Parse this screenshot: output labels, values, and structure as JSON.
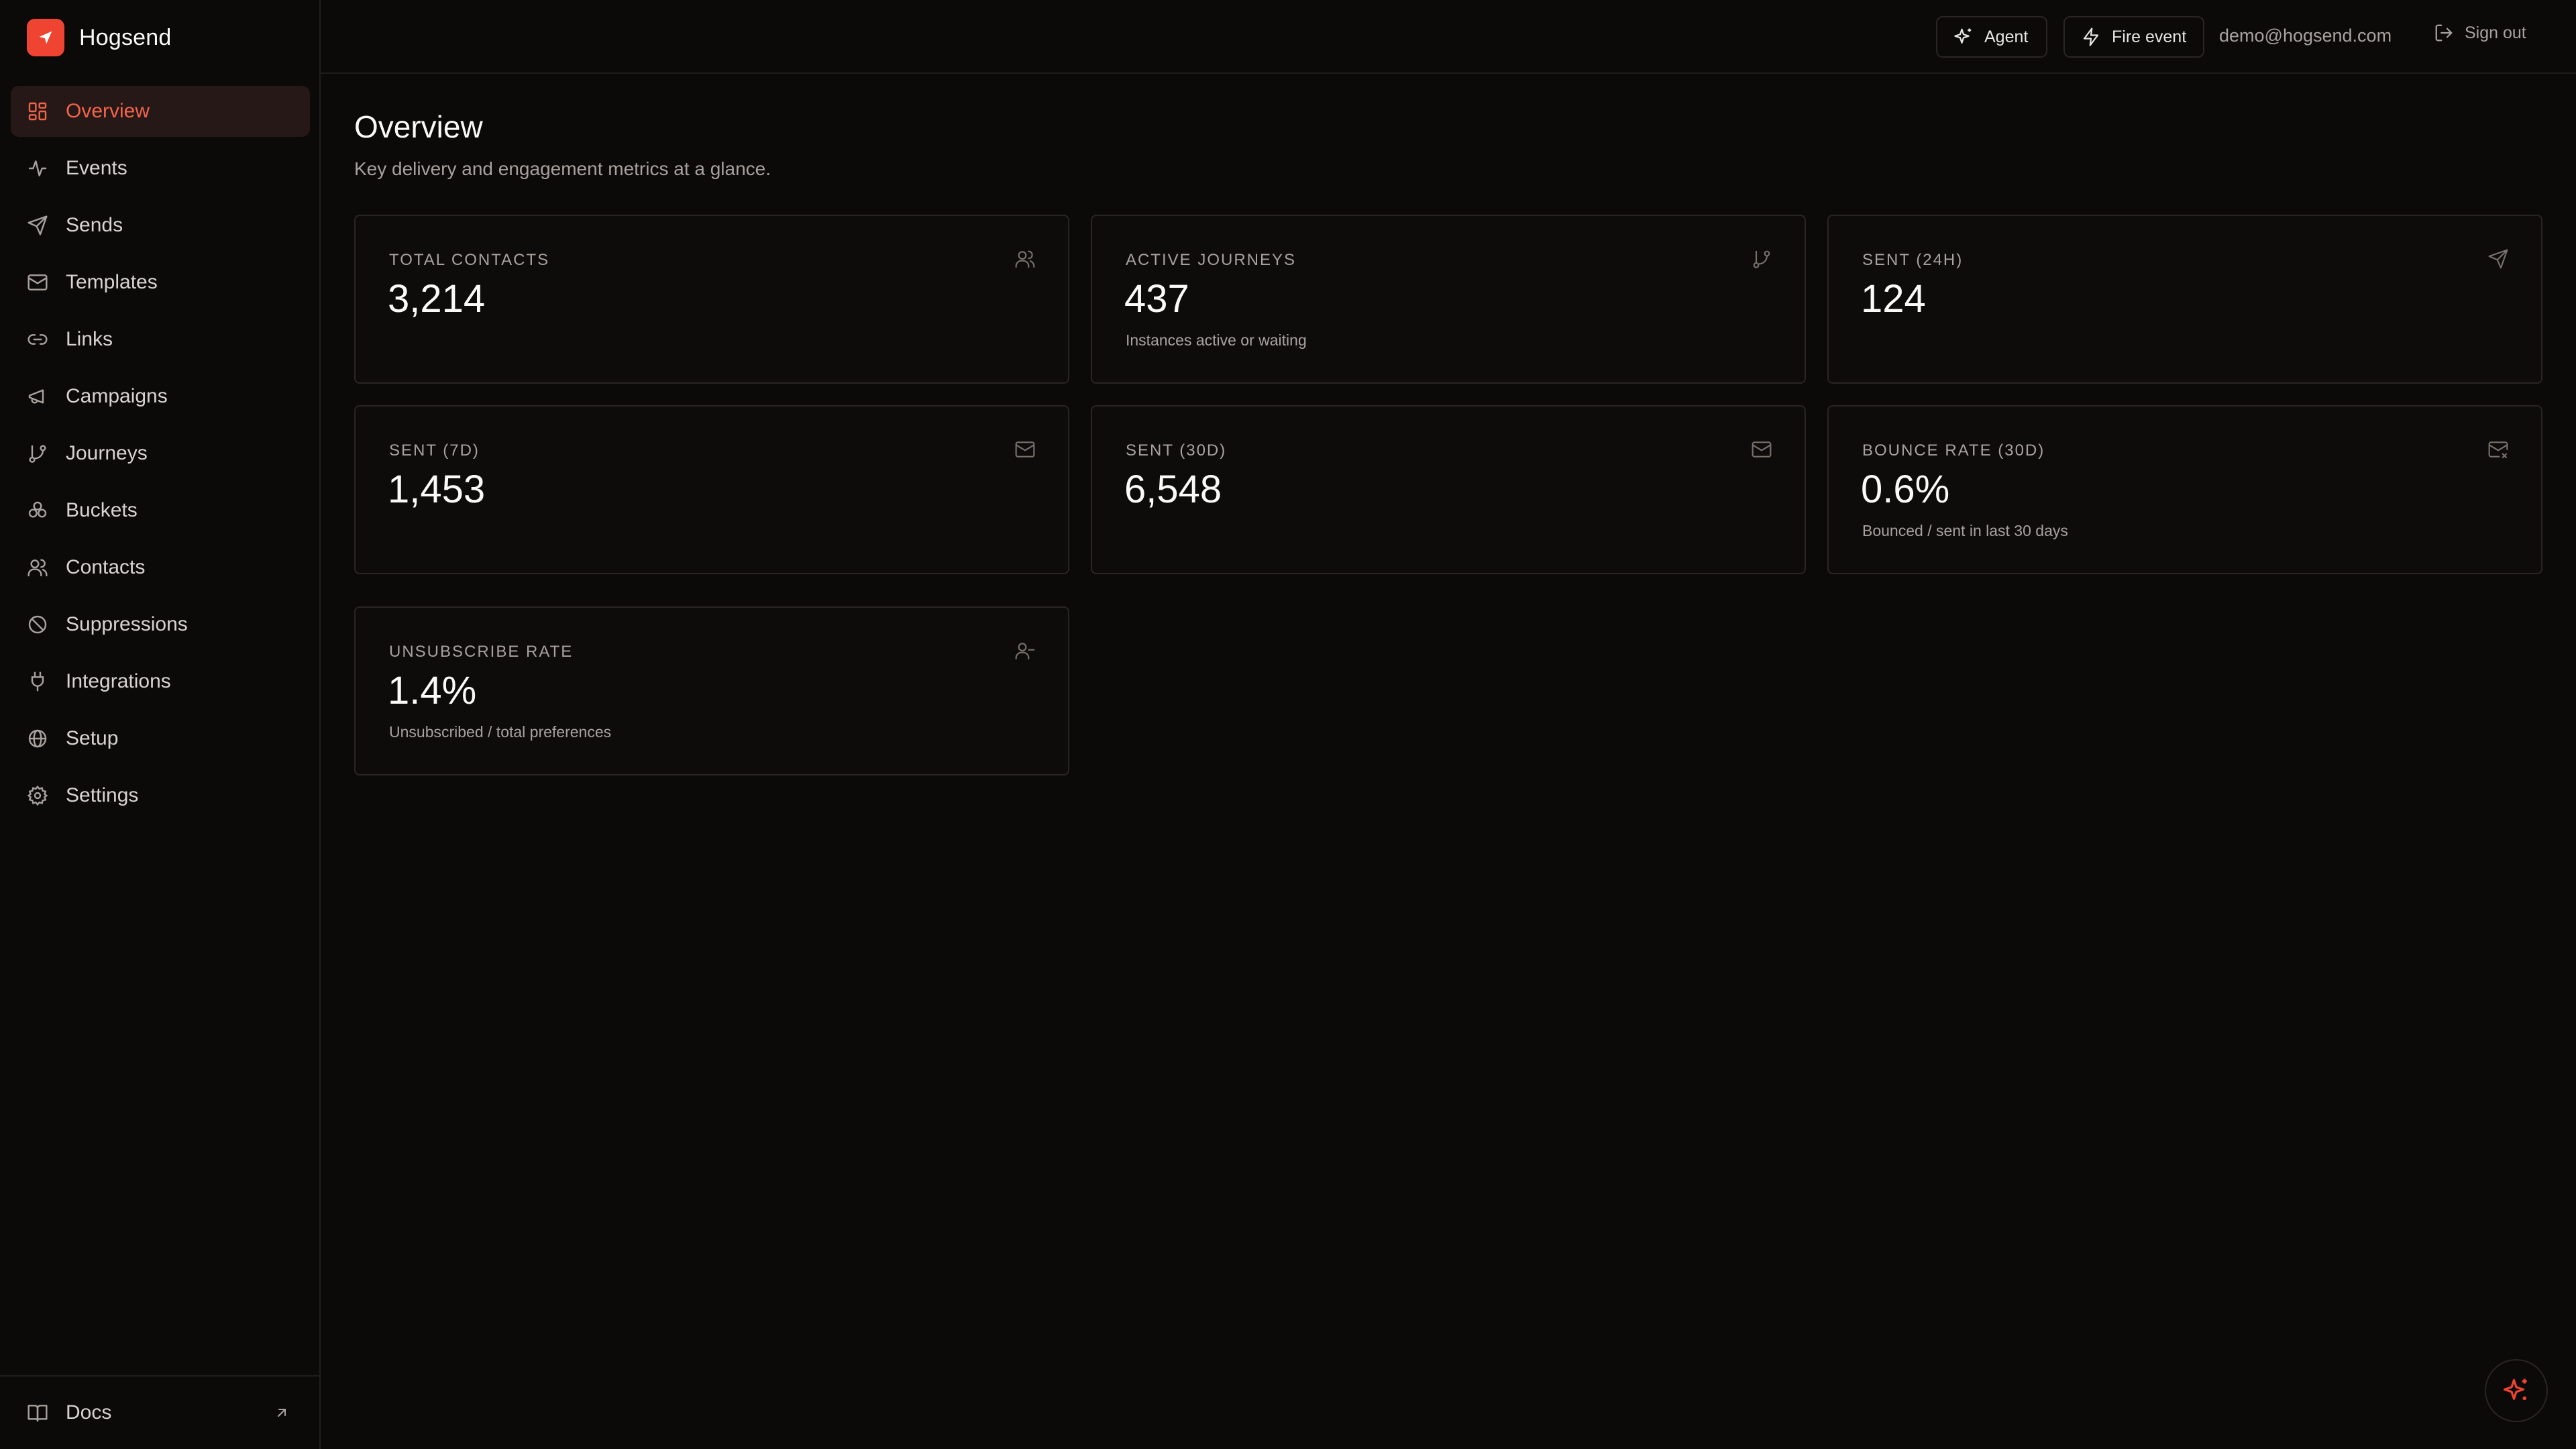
{
  "brand": {
    "name": "Hogsend",
    "accent": "#ef4432"
  },
  "sidebar": {
    "items": [
      {
        "label": "Overview",
        "icon": "dashboard-icon",
        "active": true
      },
      {
        "label": "Events",
        "icon": "activity-icon"
      },
      {
        "label": "Sends",
        "icon": "send-icon"
      },
      {
        "label": "Templates",
        "icon": "mail-icon"
      },
      {
        "label": "Links",
        "icon": "link-icon"
      },
      {
        "label": "Campaigns",
        "icon": "megaphone-icon"
      },
      {
        "label": "Journeys",
        "icon": "git-branch-icon"
      },
      {
        "label": "Buckets",
        "icon": "boxes-icon"
      },
      {
        "label": "Contacts",
        "icon": "users-icon"
      },
      {
        "label": "Suppressions",
        "icon": "ban-icon"
      },
      {
        "label": "Integrations",
        "icon": "plug-icon"
      },
      {
        "label": "Setup",
        "icon": "globe-icon"
      },
      {
        "label": "Settings",
        "icon": "gear-icon"
      }
    ],
    "footer": {
      "label": "Docs",
      "icon": "book-icon"
    }
  },
  "header": {
    "agent_label": "Agent",
    "fire_event_label": "Fire event",
    "user_email": "demo@hogsend.com",
    "sign_out_label": "Sign out"
  },
  "page": {
    "title": "Overview",
    "subtitle": "Key delivery and engagement metrics at a glance."
  },
  "metrics": [
    {
      "label": "Total contacts",
      "value": "3,214",
      "note": "",
      "icon": "users-icon"
    },
    {
      "label": "Active journeys",
      "value": "437",
      "note": "Instances active or waiting",
      "icon": "git-branch-icon"
    },
    {
      "label": "Sent (24h)",
      "value": "124",
      "note": "",
      "icon": "send-icon"
    },
    {
      "label": "Sent (7d)",
      "value": "1,453",
      "note": "",
      "icon": "mail-icon"
    },
    {
      "label": "Sent (30d)",
      "value": "6,548",
      "note": "",
      "icon": "mail-icon"
    },
    {
      "label": "Bounce rate (30d)",
      "value": "0.6%",
      "note": "Bounced / sent in last 30 days",
      "icon": "mail-x-icon"
    },
    {
      "label": "Unsubscribe rate",
      "value": "1.4%",
      "note": "Unsubscribed / total preferences",
      "icon": "user-minus-icon"
    }
  ]
}
